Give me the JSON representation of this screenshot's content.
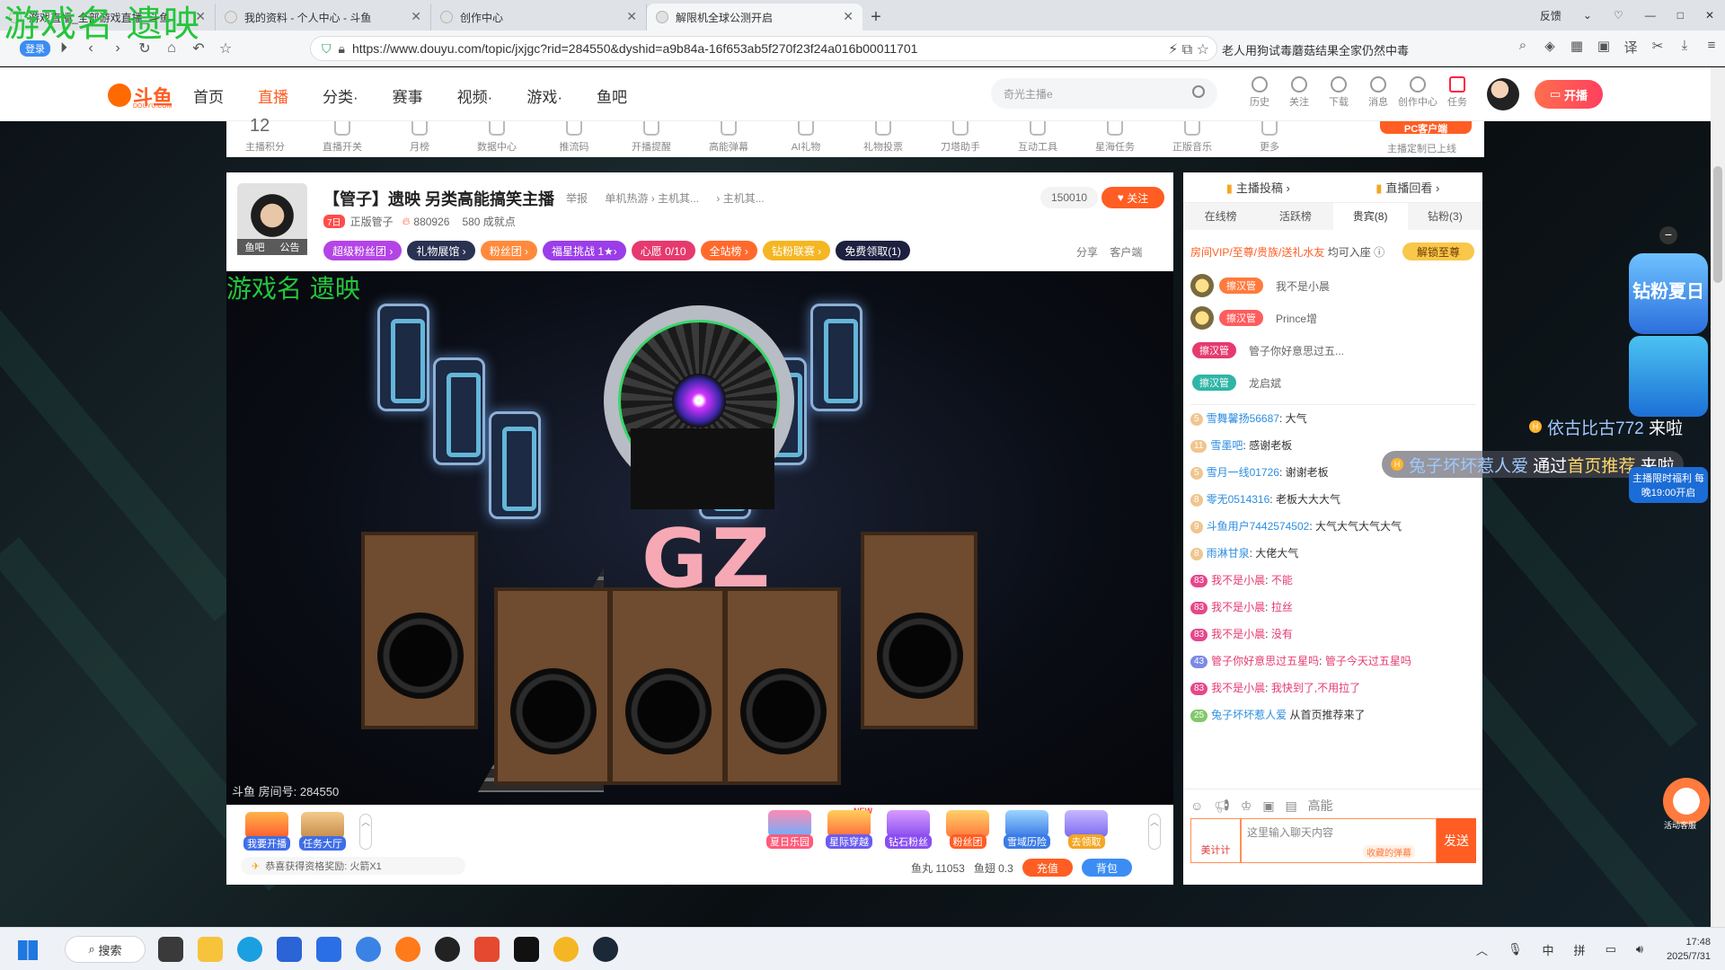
{
  "overlay": {
    "top": "游戏名 遗映",
    "video": "游戏名 遗映"
  },
  "browser": {
    "tabs": [
      {
        "label": "游戏直播_全部游戏直播_斗鱼",
        "active": false
      },
      {
        "label": "我的资料 - 个人中心 - 斗鱼",
        "active": false
      },
      {
        "label": "创作中心",
        "active": false
      },
      {
        "label": "解限机全球公测开启",
        "active": true
      }
    ],
    "login_label": "登录",
    "url": "https://www.douyu.com/topic/jxjgc?rid=284550&dyshid=a9b84a-16f653ab5f270f23f24a016b00011701",
    "news": "老人用狗试毒蘑菇结果全家仍然中毒",
    "window_controls": [
      "反馈",
      "—",
      "□",
      "✕"
    ]
  },
  "site_header": {
    "logo_text": "斗鱼",
    "logo_sub": "DOUYU.COM",
    "nav": [
      "首页",
      "直播",
      "分类·",
      "赛事",
      "视频·",
      "游戏·",
      "鱼吧"
    ],
    "active_nav": "直播",
    "search_placeholder": "奇光主播e",
    "tools": [
      "历史",
      "关注",
      "下载",
      "消息",
      "创作中心",
      "任务"
    ],
    "kaibo_label": "开播"
  },
  "tool_strip": {
    "items": [
      "主播积分",
      "直播开关",
      "月榜",
      "数据中心",
      "推流码",
      "开播提醒",
      "高能弹幕",
      "AI礼物",
      "礼物投票",
      "刀塔助手",
      "互动工具",
      "星海任务",
      "正版音乐",
      "更多"
    ],
    "score": "12",
    "pc_client": "PC客户端",
    "pc_note": "主播定制已上线"
  },
  "room": {
    "avatar_caption_left": "鱼吧",
    "avatar_caption_right": "公告",
    "title": "【管子】遗映 另类高能搞笑主播",
    "report": "举报",
    "category1": "单机热游 › 主机其...",
    "category2": "› 主机其...",
    "anchor_level": "7日",
    "anchor_name": "正版管子",
    "hot": "880926",
    "achievement": "580 成就点",
    "follow_count": "150010",
    "follow_label": "关注",
    "badges": [
      {
        "label": "超级粉丝团 ›",
        "color": "#b444e6"
      },
      {
        "label": "礼物展馆 ›",
        "color": "#2a3252"
      },
      {
        "label": "粉丝团 ›",
        "color": "#ff8a3d"
      },
      {
        "label": "福星挑战 1★›",
        "color": "#9b3de8"
      },
      {
        "label": "心愿 0/10",
        "color": "#e63a6f"
      },
      {
        "label": "全站榜 ›",
        "color": "#ff6a2c"
      },
      {
        "label": "钻粉联赛 ›",
        "color": "#f5b623"
      },
      {
        "label": "免费领取(1)",
        "color": "#1e2040"
      }
    ],
    "share": "分享",
    "client": "客户端",
    "room_number": "斗鱼 房间号: 284550",
    "gz_text": "GZ"
  },
  "video_bottom": {
    "left_items": [
      "我要开播",
      "任务大厅"
    ],
    "reward_note": "恭喜获得资格奖励: 火箭X1",
    "right_items": [
      "夏日乐园",
      "星际穿越",
      "钻石粉丝",
      "粉丝团",
      "雪域历险",
      "去领取"
    ],
    "new_tag": "NEW",
    "fish_balls": "鱼丸 11053",
    "fish_fins": "鱼翅 0.3",
    "recharge": "充值",
    "backpack": "背包"
  },
  "side_panel": {
    "top_links": [
      "主播投稿 ›",
      "直播回看 ›"
    ],
    "rank_tabs": [
      "在线榜",
      "活跃榜",
      "贵宾(8)",
      "钻粉(3)"
    ],
    "active_rank": "贵宾(8)",
    "vip_note_a": "房间VIP/至尊/贵族/送礼水友",
    "vip_note_b": "均可入座",
    "vip_btn": "解锁至尊",
    "vip_rows": [
      {
        "role": "擦汉管",
        "name": "我不是小晨",
        "color": "#ff7a3d"
      },
      {
        "role": "擦汉管",
        "name": "Prince增",
        "color": "#ff5c5c"
      },
      {
        "role": "擦汉管",
        "name": "管子你好意思过五...",
        "color": "#e63a6f"
      },
      {
        "role": "擦汉管",
        "name": "龙启斌",
        "color": "#2fb5a6"
      }
    ],
    "messages": [
      {
        "lvl": "5",
        "user": "雪舞馨扬56687",
        "text": "大气",
        "style": "n"
      },
      {
        "lvl": "11",
        "user": "雪墨吧",
        "text": "感谢老板",
        "style": "n"
      },
      {
        "lvl": "5",
        "user": "雪月一线01726",
        "text": "谢谢老板",
        "style": "n"
      },
      {
        "lvl": "8",
        "user": "零无0514316",
        "text": "老板大大大气",
        "style": "n"
      },
      {
        "lvl": "9",
        "user": "斗鱼用户7442574502",
        "text": "大气大气大气大气",
        "style": "n"
      },
      {
        "lvl": "8",
        "user": "雨淋甘泉",
        "text": "大佬大气",
        "style": "n"
      },
      {
        "lvl": "83",
        "user": "我不是小晨",
        "text": "不能",
        "style": "pk"
      },
      {
        "lvl": "83",
        "user": "我不是小晨",
        "text": "拉丝",
        "style": "pk"
      },
      {
        "lvl": "83",
        "user": "我不是小晨",
        "text": "没有",
        "style": "pk"
      },
      {
        "lvl": "43",
        "user": "管子你好意思过五星吗",
        "text": "管子今天过五星吗",
        "style": "pk"
      },
      {
        "lvl": "83",
        "user": "我不是小晨",
        "text": "我快到了,不用拉了",
        "style": "pk"
      },
      {
        "lvl": "25",
        "user": "兔子坏坏惹人爱",
        "text": "从首页推荐来了",
        "style": "gn"
      }
    ],
    "input_placeholder": "这里输入聊天内容",
    "danmu_tag": "收藏的弹幕",
    "send_label": "发送",
    "counter_label": "美计计",
    "high_label": "高能"
  },
  "floating": {
    "notice1_user": "依古比古772",
    "notice1_text": "来啦",
    "notice2_user": "兔子坏坏惹人爱",
    "notice2_mid": "通过",
    "notice2_src": "首页推荐",
    "notice2_end": "来啦",
    "promo_title": "钻粉夏日乐园",
    "promo_note": "主播限时福利 每晚19:00开启",
    "support_label": "活动客服"
  },
  "taskbar": {
    "search_label": "搜索",
    "ime1": "中",
    "ime2": "拼",
    "time": "17:48",
    "date": "2025/7/31"
  }
}
